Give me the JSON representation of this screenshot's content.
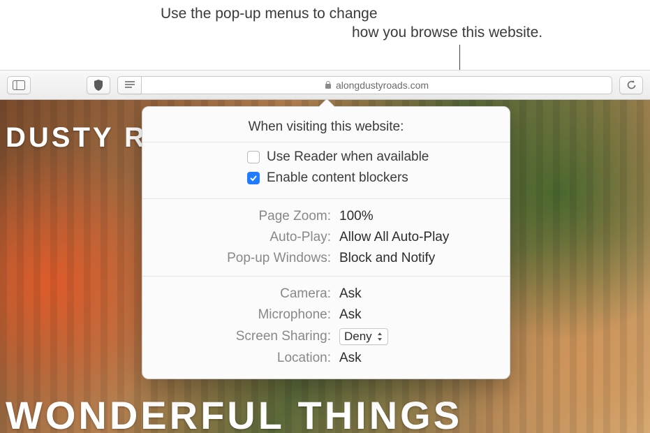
{
  "caption": {
    "line1": "Use the pop-up menus to change",
    "line2": "how you browse this website."
  },
  "toolbar": {
    "url": "alongdustyroads.com"
  },
  "page": {
    "overlay_text_top": "DUSTY R",
    "overlay_text_bottom": "WONDERFUL THINGS"
  },
  "popover": {
    "title": "When visiting this website:",
    "useReader": {
      "label": "Use Reader when available",
      "checked": false
    },
    "contentBlockers": {
      "label": "Enable content blockers",
      "checked": true
    },
    "rows1": {
      "pageZoom": {
        "label": "Page Zoom:",
        "value": "100%"
      },
      "autoPlay": {
        "label": "Auto-Play:",
        "value": "Allow All Auto-Play"
      },
      "popups": {
        "label": "Pop-up Windows:",
        "value": "Block and Notify"
      }
    },
    "rows2": {
      "camera": {
        "label": "Camera:",
        "value": "Ask"
      },
      "microphone": {
        "label": "Microphone:",
        "value": "Ask"
      },
      "screenSharing": {
        "label": "Screen Sharing:",
        "value": "Deny"
      },
      "location": {
        "label": "Location:",
        "value": "Ask"
      }
    }
  }
}
